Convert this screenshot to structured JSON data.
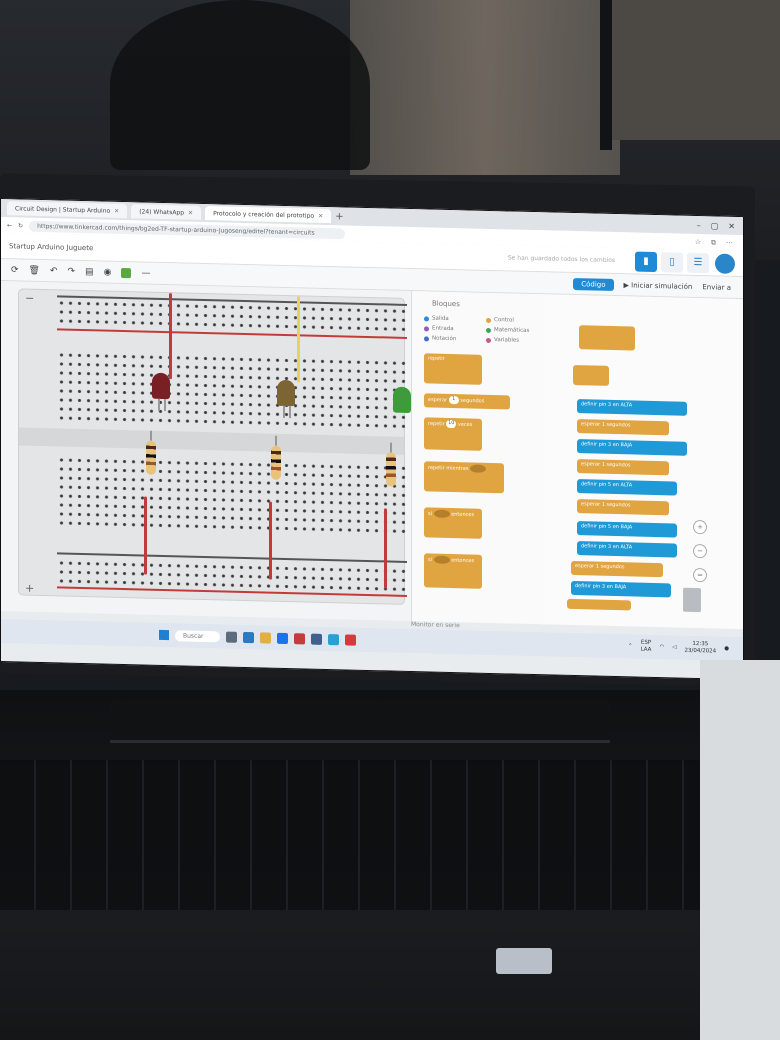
{
  "browser": {
    "tabs": [
      {
        "label": "Circuit Design | Startup Arduino",
        "active": false
      },
      {
        "label": "(24) WhatsApp",
        "active": false
      },
      {
        "label": "Protocolo y creación del prototipo",
        "active": true
      }
    ],
    "url": "https://www.tinkercad.com/things/bg2ed-TF-startup-arduino-Jugoseng/editel?tenant=circuits"
  },
  "app": {
    "title": "Startup Arduino Juguete",
    "saved_status": "Se han guardado todos los cambios"
  },
  "toolbar": {
    "code_label": "Código",
    "simulate_label": "Iniciar simulación",
    "send_label": "Enviar a"
  },
  "palette": {
    "title": "Bloques",
    "categories": [
      {
        "label": "Salida",
        "color": "#2c8ad6"
      },
      {
        "label": "Control",
        "color": "#e0a441"
      },
      {
        "label": "Entrada",
        "color": "#8a5bc7"
      },
      {
        "label": "Matemáticas",
        "color": "#3fa55b"
      },
      {
        "label": "Notación",
        "color": "#3f70c7"
      },
      {
        "label": "Variables",
        "color": "#c25c8b"
      }
    ],
    "blocks": [
      {
        "label": "repetir"
      },
      {
        "label": "esperar",
        "num": "1",
        "unit": "segundos"
      },
      {
        "label": "repetir",
        "num": "10",
        "unit": "veces"
      },
      {
        "label": "repetir",
        "mode": "mientras"
      },
      {
        "label": "si",
        "mode": "entonces"
      },
      {
        "label": "si",
        "mode": "entonces"
      }
    ]
  },
  "workspace": {
    "code_lines": [
      {
        "kind": "blue",
        "text": "definir pin 3 en ALTA"
      },
      {
        "kind": "orange",
        "text": "esperar 1 segundos"
      },
      {
        "kind": "blue",
        "text": "definir pin 3 en BAJA"
      },
      {
        "kind": "orange",
        "text": "esperar 1 segundos"
      },
      {
        "kind": "blue",
        "text": "definir pin 5 en ALTA"
      },
      {
        "kind": "orange",
        "text": "esperar 1 segundos"
      },
      {
        "kind": "blue",
        "text": "definir pin 5 en BAJA"
      },
      {
        "kind": "blue",
        "text": "definir pin 3 en ALTA"
      },
      {
        "kind": "orange",
        "text": "esperar 1 segundos"
      },
      {
        "kind": "blue",
        "text": "definir pin 3 en BAJA"
      }
    ],
    "serial_label": "Monitor en serie"
  },
  "taskbar": {
    "search": "Buscar",
    "lang": "ESP",
    "region": "LAA",
    "time": "12:35",
    "date": "23/04/2024"
  },
  "colors": {
    "led_red": "#7a1f24",
    "led_yellow": "#7d6434",
    "led_green": "#3e9b3b",
    "wire_red": "#c23b3b",
    "wire_yellow": "#e5d35a",
    "wire_green": "#4aa043",
    "accent": "#1f8ad6"
  }
}
